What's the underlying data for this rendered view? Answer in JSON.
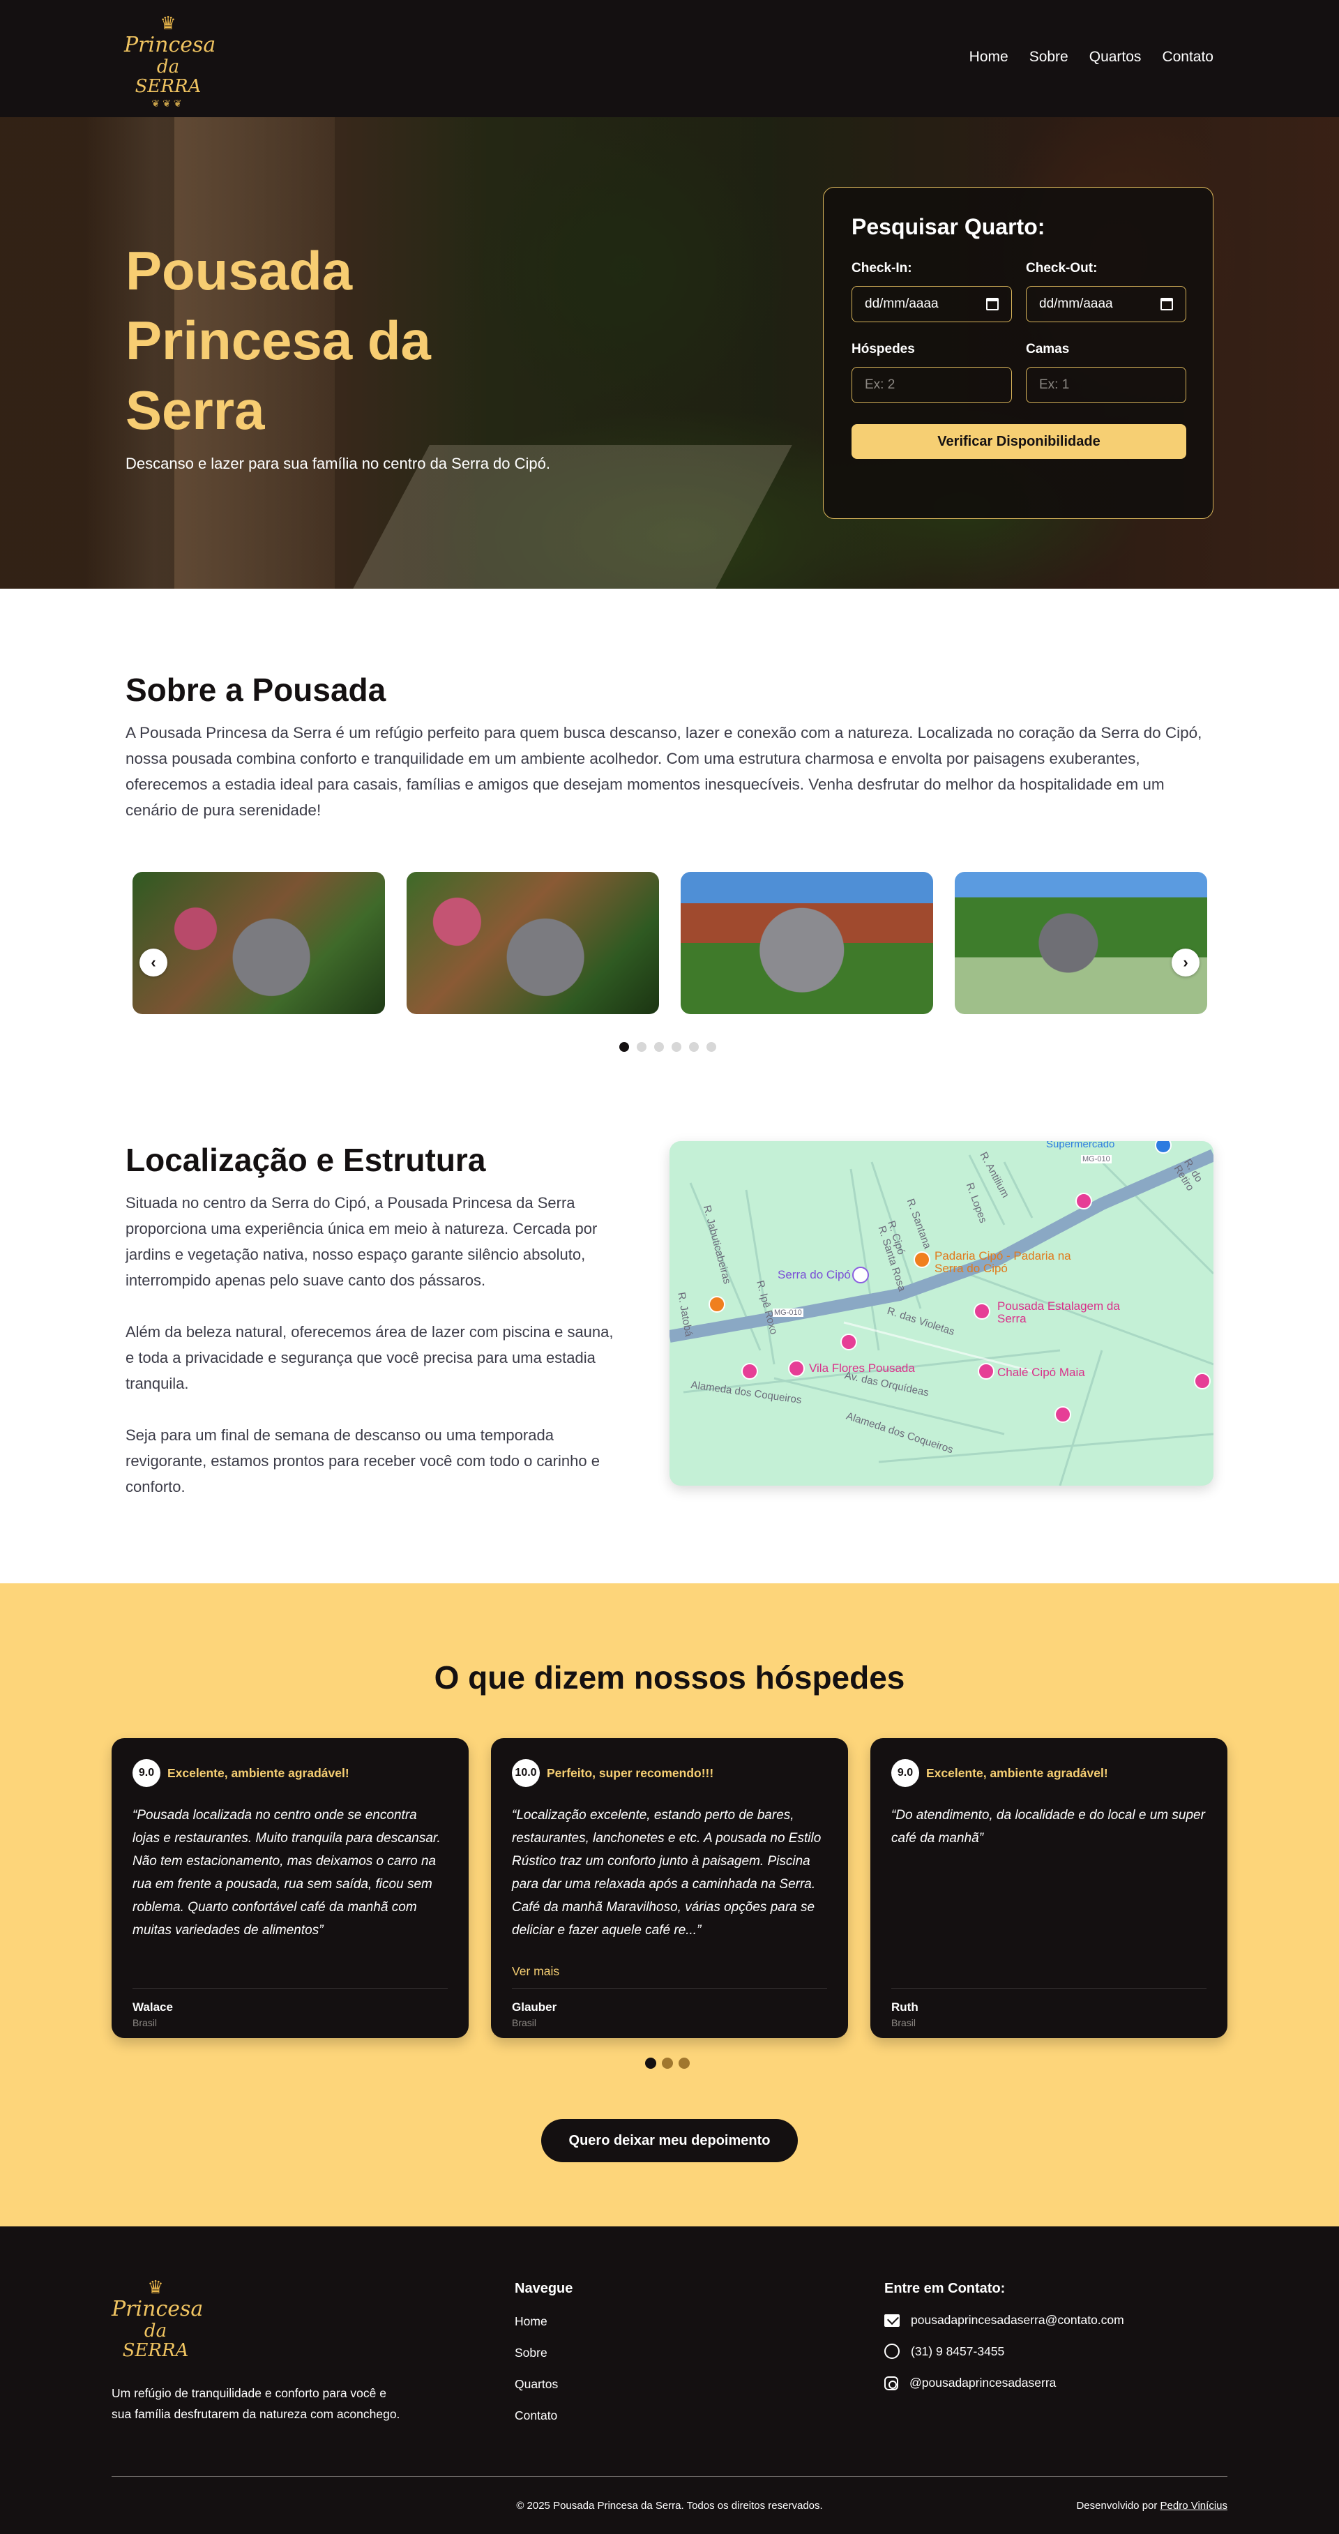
{
  "brand": {
    "logo_line1": "Princesa",
    "logo_line2": "da SERRA"
  },
  "nav": [
    "Home",
    "Sobre",
    "Quartos",
    "Contato"
  ],
  "hero": {
    "title": "Pousada Princesa da Serra",
    "subtitle": "Descanso e lazer para sua família no centro da Serra do Cipó."
  },
  "search": {
    "title": "Pesquisar Quarto:",
    "checkin_label": "Check-In:",
    "checkin_value": "dd/mm/aaaa",
    "checkout_label": "Check-Out:",
    "checkout_value": "dd/mm/aaaa",
    "guests_label": "Hóspedes",
    "guests_placeholder": "Ex: 2",
    "beds_label": "Camas",
    "beds_placeholder": "Ex: 1",
    "button": "Verificar Disponibilidade"
  },
  "about": {
    "title": "Sobre a Pousada",
    "text": "A Pousada Princesa da Serra é um refúgio perfeito para quem busca descanso, lazer e conexão com a natureza. Localizada no coração da Serra do Cipó, nossa pousada combina conforto e tranquilidade em um ambiente acolhedor. Com uma estrutura charmosa e envolta por paisagens exuberantes, oferecemos a estadia ideal para casais, famílias e amigos que desejam momentos inesquecíveis. Venha desfrutar do melhor da hospitalidade em um cenário de pura serenidade!"
  },
  "carousel": {
    "prev": "‹",
    "next": "›",
    "dots": 6,
    "active_dot": 1
  },
  "location": {
    "title": "Localização e Estrutura",
    "paragraphs": [
      "Situada no centro da Serra do Cipó, a Pousada Princesa da Serra proporciona uma experiência única em meio à natureza. Cercada por jardins e vegetação nativa, nosso espaço garante silêncio absoluto, interrompido apenas pelo suave canto dos pássaros.",
      "Além da beleza natural, oferecemos área de lazer com piscina e sauna, e toda a privacidade e segurança que você precisa para uma estadia tranquila.",
      "Seja para um final de semana de descanso ou uma temporada revigorante, estamos prontos para receber você com todo o carinho e conforto."
    ]
  },
  "map": {
    "labels": {
      "supermercado": "Supermercado",
      "r_retiro": "R. do Retiro",
      "r_antilium": "R. Antilium",
      "r_lopes": "R. Lopes",
      "r_santana": "R. Santana",
      "r_santa_rosa": "R. Santa Rosa",
      "r_cipo": "R. Cipó",
      "r_jabuticabeiras": "R. Jabuticabeiras",
      "r_ipe_roxo": "R. Ipê Roxo",
      "r_jatoba": "R. Jatobá",
      "mg010_a": "MG-010",
      "mg010_b": "MG-010",
      "r_violetas": "R. das Violetas",
      "av_orquideas": "Av. das Orquídeas",
      "alameda_1": "Alameda dos Coqueiros",
      "alameda_2": "Alameda dos Coqueiros",
      "serra_cipo": "Serra do Cipó",
      "padaria": "Padaria Cipó - Padaria na Serra do Cipó",
      "estalagem": "Pousada Estalagem da Serra",
      "vila_flores": "Vila Flores Pousada",
      "chale": "Chalé Cipó Maia"
    }
  },
  "testimonials": {
    "title": "O que dizem nossos hóspedes",
    "items": [
      {
        "score": "9.0",
        "headline": "Excelente, ambiente agradável!",
        "quote": "“Pousada localizada no centro onde se encontra lojas e restaurantes. Muito tranquila para descansar. Não tem estacionamento, mas deixamos o carro na rua em frente a pousada, rua sem saída, ficou sem roblema. Quarto confortável café da manhã com muitas variedades de alimentos”",
        "more": "",
        "name": "Walace",
        "country": "Brasil"
      },
      {
        "score": "10.0",
        "headline": "Perfeito, super recomendo!!!",
        "quote": "“Localização excelente, estando perto de bares, restaurantes, lanchonetes e etc. A pousada no Estilo Rústico traz um conforto junto à paisagem. Piscina para dar uma relaxada após a caminhada na Serra. Café da manhã Maravilhoso, várias opções para se deliciar e fazer aquele café re...”",
        "more": "Ver mais",
        "name": "Glauber",
        "country": "Brasil"
      },
      {
        "score": "9.0",
        "headline": "Excelente, ambiente agradável!",
        "quote": "“Do atendimento, da localidade e do local e um super café da manhã”",
        "more": "",
        "name": "Ruth",
        "country": "Brasil"
      }
    ],
    "button": "Quero deixar meu depoimento"
  },
  "footer": {
    "description": "Um refúgio de tranquilidade e conforto para você e sua família desfrutarem da natureza com aconchego.",
    "nav_title": "Navegue",
    "nav_links": [
      "Home",
      "Sobre",
      "Quartos",
      "Contato"
    ],
    "contact_title": "Entre em Contato:",
    "email": "pousadaprincesadaserra@contato.com",
    "phone": "(31) 9 8457-3455",
    "instagram": "@pousadaprincesadaserra",
    "copyright": "© 2025 Pousada Princesa da Serra. Todos os direitos reservados.",
    "dev_prefix": "Desenvolvido por",
    "dev_name": "Pedro Vinícius"
  },
  "colors": {
    "dark": "#141011",
    "gold": "#f6cf73",
    "hero_title": "#f7cd72",
    "testimonial_bg": "#fdd57a",
    "map_bg": "#c4f0d6"
  }
}
